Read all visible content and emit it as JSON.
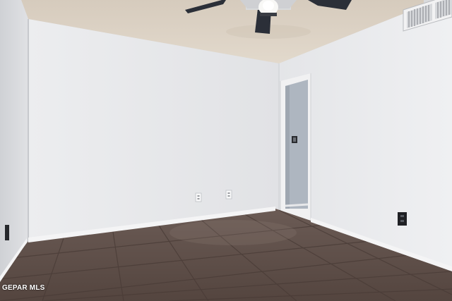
{
  "watermark": {
    "text": "GEPAR MLS"
  },
  "room": {
    "ceiling": {
      "fixture": "ceiling-fan-with-light",
      "vent": "hvac-return-vent"
    },
    "walls": {
      "color": "#e6e7e9",
      "baseboard": "white"
    },
    "floor": {
      "material": "tile",
      "color": "#5a4b45"
    },
    "doorway": {
      "state": "open",
      "hall_wall_color": "#aeb6c0"
    },
    "outlets": [
      "left-wall-outlet",
      "back-wall-outlet-1",
      "back-wall-outlet-2",
      "right-wall-outlet"
    ]
  }
}
